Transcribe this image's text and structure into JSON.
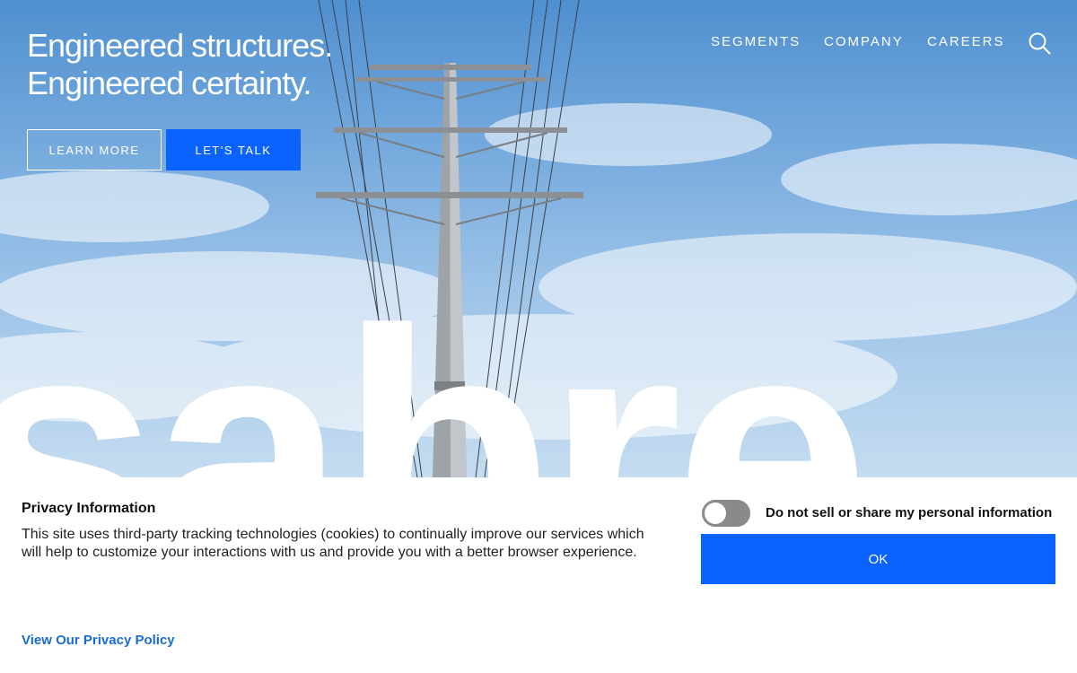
{
  "hero": {
    "headline_line1": "Engineered structures.",
    "headline_line2": "Engineered certainty.",
    "learn_more_label": "LEARN MORE",
    "lets_talk_label": "LET'S TALK",
    "watermark_text": "sabre",
    "accent_color": "#0a63ff"
  },
  "nav": {
    "items": [
      {
        "label": "SEGMENTS"
      },
      {
        "label": "COMPANY"
      },
      {
        "label": "CAREERS"
      }
    ],
    "search_icon": "search-icon"
  },
  "cookie_banner": {
    "title": "Privacy Information",
    "body": "This site uses third-party tracking technologies (cookies) to continually improve our services which will help to customize your interactions with us and provide you with a better browser experience.",
    "toggle_label": "Do not sell or share my personal information",
    "toggle_state": "off",
    "ok_label": "OK",
    "policy_link": "View Our Privacy Policy"
  }
}
